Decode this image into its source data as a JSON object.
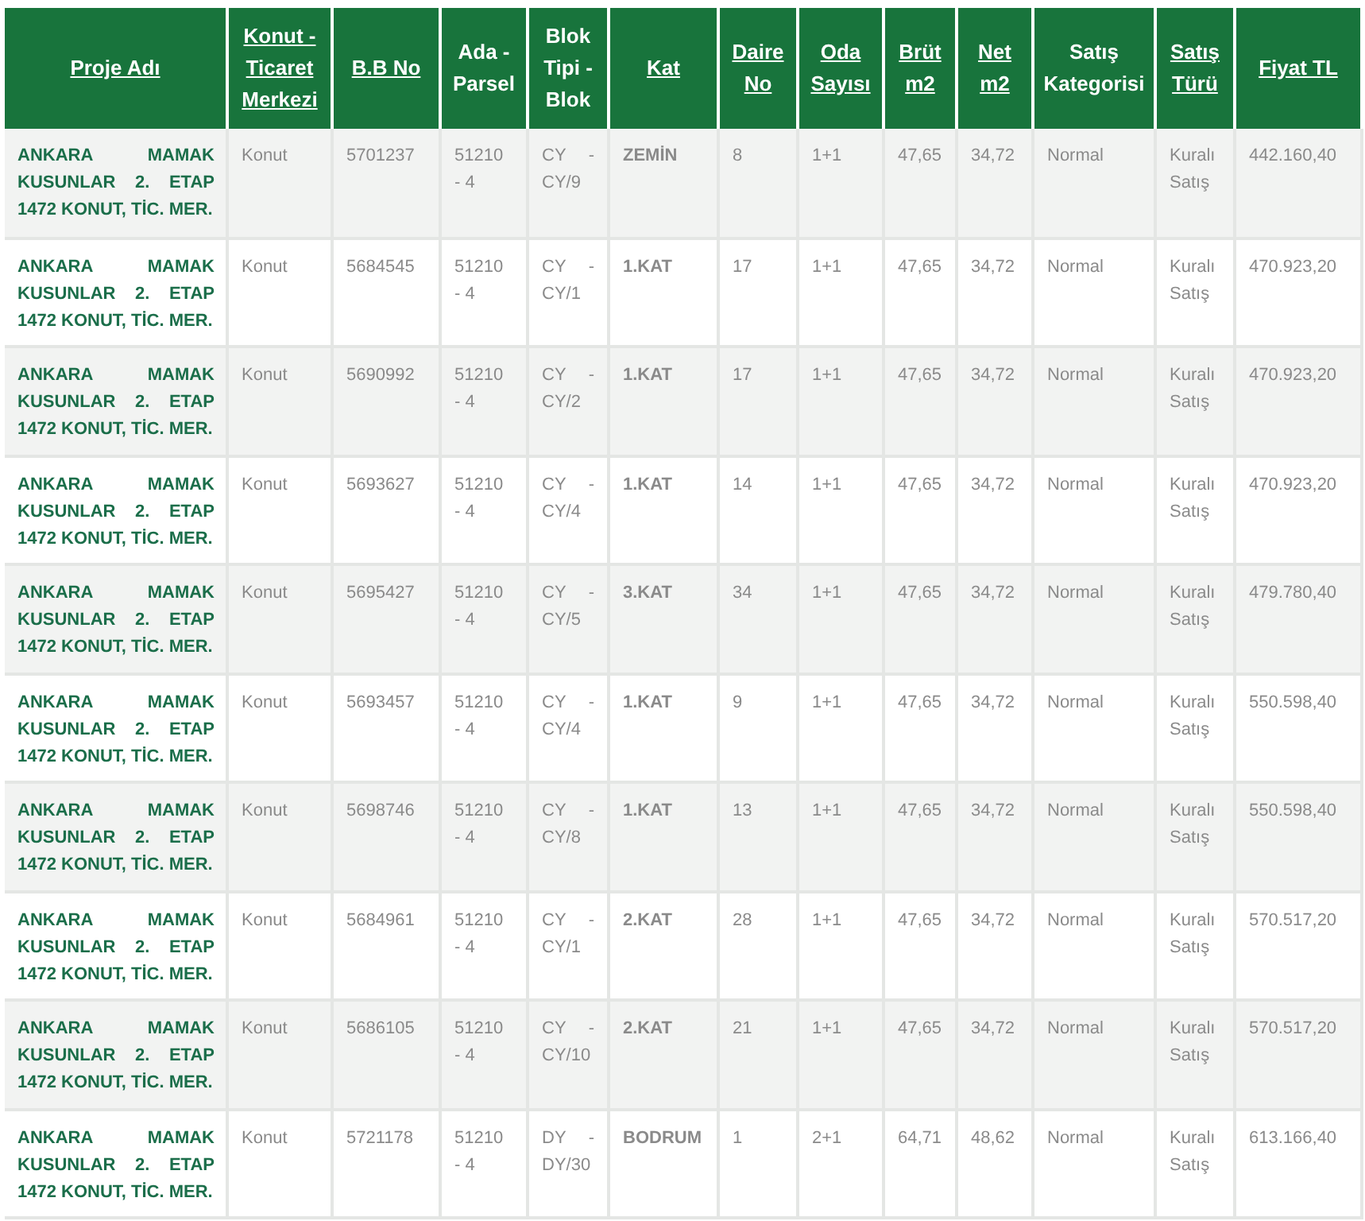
{
  "table": {
    "columns": [
      {
        "label": "Proje Adı",
        "sortable": true
      },
      {
        "label": "Konut - Ticaret Merkezi",
        "sortable": true
      },
      {
        "label": "B.B No",
        "sortable": true
      },
      {
        "label": "Ada - Parsel",
        "sortable": false
      },
      {
        "label": "Blok Tipi - Blok",
        "sortable": false
      },
      {
        "label": "Kat",
        "sortable": true
      },
      {
        "label": "Daire No",
        "sortable": true
      },
      {
        "label": "Oda Sayısı",
        "sortable": true
      },
      {
        "label": "Brüt m2",
        "sortable": true
      },
      {
        "label": "Net m2",
        "sortable": true
      },
      {
        "label": "Satış Kategorisi",
        "sortable": false
      },
      {
        "label": "Satış Türü",
        "sortable": true
      },
      {
        "label": "Fiyat TL",
        "sortable": true
      }
    ],
    "rows": [
      [
        "ANKARA MAMAK KUSUNLAR 2. ETAP 1472 KONUT, TİC. MER.",
        "Konut",
        "5701237",
        "51210 - 4",
        "CY - CY/9",
        "ZEMİN",
        "8",
        "1+1",
        "47,65",
        "34,72",
        "Normal",
        "Kuralı Satış",
        "442.160,40"
      ],
      [
        "ANKARA MAMAK KUSUNLAR 2. ETAP 1472 KONUT, TİC. MER.",
        "Konut",
        "5684545",
        "51210 - 4",
        "CY - CY/1",
        "1.KAT",
        "17",
        "1+1",
        "47,65",
        "34,72",
        "Normal",
        "Kuralı Satış",
        "470.923,20"
      ],
      [
        "ANKARA MAMAK KUSUNLAR 2. ETAP 1472 KONUT, TİC. MER.",
        "Konut",
        "5690992",
        "51210 - 4",
        "CY - CY/2",
        "1.KAT",
        "17",
        "1+1",
        "47,65",
        "34,72",
        "Normal",
        "Kuralı Satış",
        "470.923,20"
      ],
      [
        "ANKARA MAMAK KUSUNLAR 2. ETAP 1472 KONUT, TİC. MER.",
        "Konut",
        "5693627",
        "51210 - 4",
        "CY - CY/4",
        "1.KAT",
        "14",
        "1+1",
        "47,65",
        "34,72",
        "Normal",
        "Kuralı Satış",
        "470.923,20"
      ],
      [
        "ANKARA MAMAK KUSUNLAR 2. ETAP 1472 KONUT, TİC. MER.",
        "Konut",
        "5695427",
        "51210 - 4",
        "CY - CY/5",
        "3.KAT",
        "34",
        "1+1",
        "47,65",
        "34,72",
        "Normal",
        "Kuralı Satış",
        "479.780,40"
      ],
      [
        "ANKARA MAMAK KUSUNLAR 2. ETAP 1472 KONUT, TİC. MER.",
        "Konut",
        "5693457",
        "51210 - 4",
        "CY - CY/4",
        "1.KAT",
        "9",
        "1+1",
        "47,65",
        "34,72",
        "Normal",
        "Kuralı Satış",
        "550.598,40"
      ],
      [
        "ANKARA MAMAK KUSUNLAR 2. ETAP 1472 KONUT, TİC. MER.",
        "Konut",
        "5698746",
        "51210 - 4",
        "CY - CY/8",
        "1.KAT",
        "13",
        "1+1",
        "47,65",
        "34,72",
        "Normal",
        "Kuralı Satış",
        "550.598,40"
      ],
      [
        "ANKARA MAMAK KUSUNLAR 2. ETAP 1472 KONUT, TİC. MER.",
        "Konut",
        "5684961",
        "51210 - 4",
        "CY - CY/1",
        "2.KAT",
        "28",
        "1+1",
        "47,65",
        "34,72",
        "Normal",
        "Kuralı Satış",
        "570.517,20"
      ],
      [
        "ANKARA MAMAK KUSUNLAR 2. ETAP 1472 KONUT, TİC. MER.",
        "Konut",
        "5686105",
        "51210 - 4",
        "CY - CY/10",
        "2.KAT",
        "21",
        "1+1",
        "47,65",
        "34,72",
        "Normal",
        "Kuralı Satış",
        "570.517,20"
      ],
      [
        "ANKARA MAMAK KUSUNLAR 2. ETAP 1472 KONUT, TİC. MER.",
        "Konut",
        "5721178",
        "51210 - 4",
        "DY - DY/30",
        "BODRUM",
        "1",
        "2+1",
        "64,71",
        "48,62",
        "Normal",
        "Kuralı Satış",
        "613.166,40"
      ]
    ]
  }
}
